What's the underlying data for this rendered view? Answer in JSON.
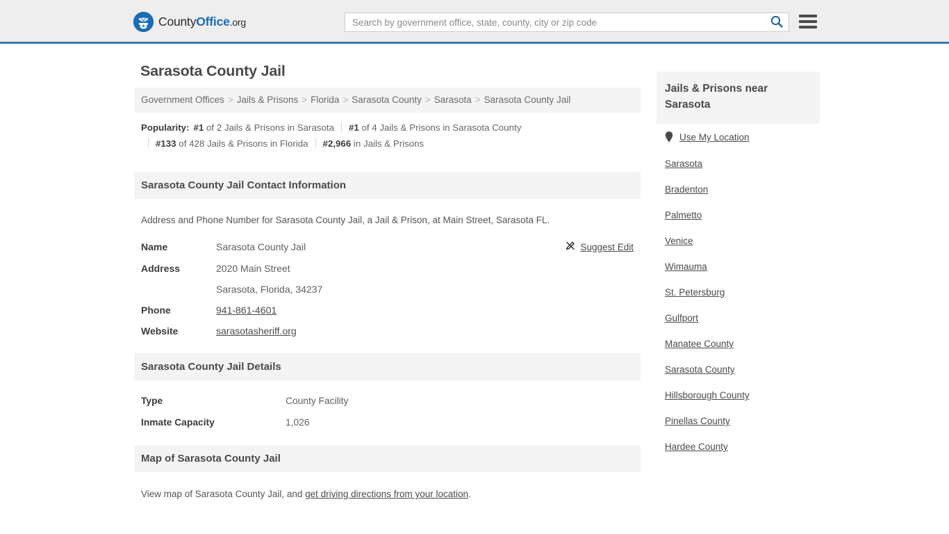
{
  "header": {
    "logo": {
      "part1": "County",
      "part2": "Office",
      "part3": ".org",
      "icon": "eagle-shield-logo"
    },
    "search": {
      "placeholder": "Search by government office, state, county, city or zip code",
      "value": "",
      "search_icon": "search-icon"
    },
    "menu_icon": "hamburger-menu-icon",
    "accent_color": "#1c6cb5",
    "border_color": "#3a78ad",
    "background": "#eeeeee"
  },
  "main": {
    "page_title": "Sarasota County Jail",
    "breadcrumb": {
      "separator": ">",
      "items": [
        "Government Offices",
        "Jails & Prisons",
        "Florida",
        "Sarasota County",
        "Sarasota",
        "Sarasota County Jail"
      ]
    },
    "popularity": {
      "label": "Popularity:",
      "items": [
        {
          "rank": "#1",
          "text": "of 2 Jails & Prisons in Sarasota"
        },
        {
          "rank": "#1",
          "text": "of 4 Jails & Prisons in Sarasota County"
        },
        {
          "rank": "#133",
          "text": "of 428 Jails & Prisons in Florida"
        },
        {
          "rank": "#2,966",
          "text": "in Jails & Prisons"
        }
      ]
    },
    "contact": {
      "heading": "Sarasota County Jail Contact Information",
      "description": "Address and Phone Number for Sarasota County Jail, a Jail & Prison, at Main Street, Sarasota FL.",
      "suggest_edit": {
        "label": "Suggest Edit",
        "icon": "edit-pencil-icon"
      },
      "rows": [
        {
          "label": "Name",
          "value": "Sarasota County Jail",
          "link": false
        },
        {
          "label": "Address",
          "value": "2020 Main Street",
          "value2": "Sarasota, Florida, 34237",
          "link": false
        },
        {
          "label": "Phone",
          "value": "941-861-4601",
          "link": true
        },
        {
          "label": "Website",
          "value": "sarasotasheriff.org",
          "link": true
        }
      ]
    },
    "details": {
      "heading": "Sarasota County Jail Details",
      "rows": [
        {
          "label": "Type",
          "value": "County Facility"
        },
        {
          "label": "Inmate Capacity",
          "value": "1,026"
        }
      ]
    },
    "map": {
      "heading": "Map of Sarasota County Jail",
      "text_before": "View map of Sarasota County Jail, and ",
      "link_text": "get driving directions from your location",
      "text_after": "."
    }
  },
  "sidebar": {
    "heading": "Jails & Prisons near Sarasota",
    "use_my_location": {
      "label": "Use My Location",
      "icon": "map-pin-icon"
    },
    "links": [
      "Sarasota",
      "Bradenton",
      "Palmetto",
      "Venice",
      "Wimauma",
      "St. Petersburg",
      "Gulfport",
      "Manatee County",
      "Sarasota County",
      "Hillsborough County",
      "Pinellas County",
      "Hardee County"
    ]
  }
}
